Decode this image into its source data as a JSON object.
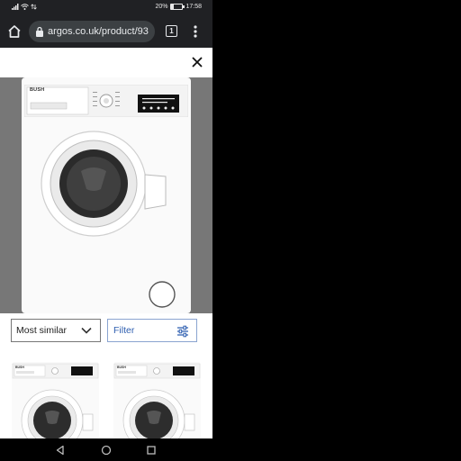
{
  "status_bar": {
    "signal": "..il",
    "battery_percent": "20%",
    "battery_level": 0.2,
    "time": "17:58"
  },
  "browser": {
    "url": "argos.co.uk/product/93",
    "tab_count": "1",
    "icons": {
      "home": "home-icon",
      "lock": "lock-icon",
      "tabs": "tabs-icon",
      "menu": "more-vert-icon"
    }
  },
  "gallery": {
    "close_icon": "close-icon",
    "product_brand": "BUSH"
  },
  "filters": {
    "sort_label": "Most similar",
    "filter_label": "Filter"
  },
  "thumbnails": [
    {
      "brand": "BUSH"
    },
    {
      "brand": "BUSH"
    }
  ],
  "nav": {
    "back": "back-triangle-icon",
    "home": "home-circle-icon",
    "recents": "recents-square-icon"
  },
  "colors": {
    "browser_chrome": "#202124",
    "filter_accent": "#2f5fb0",
    "image_background": "#777777"
  }
}
